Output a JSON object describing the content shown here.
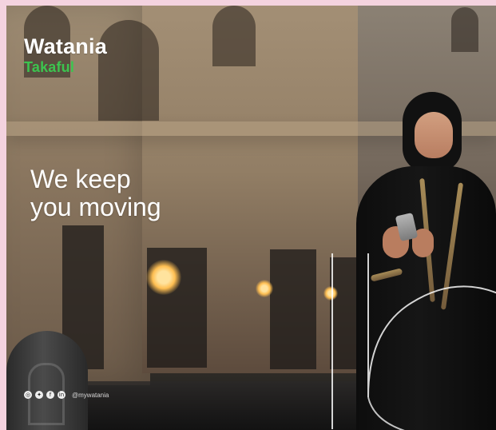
{
  "brand": {
    "name": "Watania",
    "subname": "Takaful",
    "colors": {
      "primary_text": "#ffffff",
      "accent": "#3cc44f",
      "page_bg": "#f4d3df"
    }
  },
  "hero": {
    "headline": "We keep\nyou moving"
  },
  "social": {
    "icons": [
      "instagram-icon",
      "twitter-icon",
      "facebook-icon",
      "linkedin-icon"
    ],
    "handle": "@mywatania"
  }
}
